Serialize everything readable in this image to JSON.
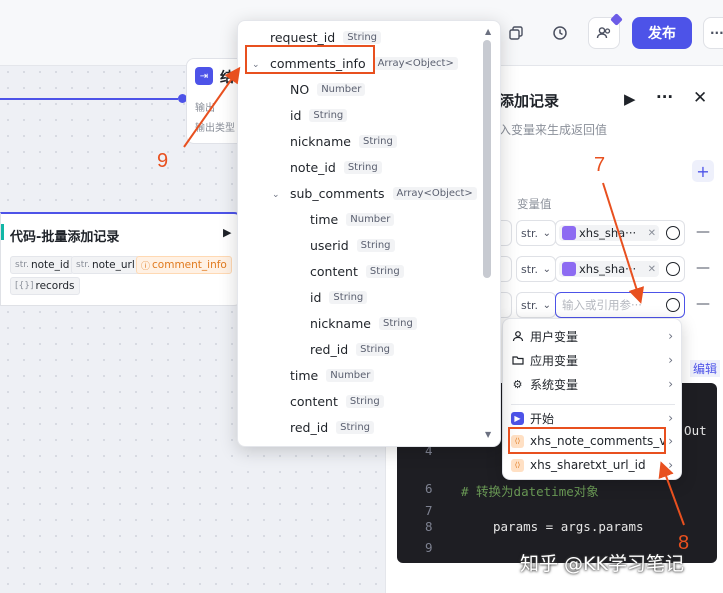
{
  "topbar": {
    "publish_label": "发布",
    "more_label": "···",
    "icons": [
      "copy-icon",
      "history-icon",
      "users-icon"
    ]
  },
  "end_node": {
    "title": "结",
    "output_label": "输出",
    "output_type_label": "输出类型"
  },
  "code_node": {
    "title": "代码-批量添加记录",
    "inputs": [
      {
        "type": "str.",
        "name": "note_id"
      },
      {
        "type": "str.",
        "name": "note_url"
      },
      {
        "type": "",
        "name": "comment_info"
      }
    ],
    "output": {
      "type": "[{}]",
      "name": "records"
    }
  },
  "tree": {
    "items": [
      {
        "name": "request_id",
        "type": "String"
      },
      {
        "name": "comments_info",
        "type": "Array<Object>"
      },
      {
        "name": "NO",
        "type": "Number"
      },
      {
        "name": "id",
        "type": "String"
      },
      {
        "name": "nickname",
        "type": "String"
      },
      {
        "name": "note_id",
        "type": "String"
      },
      {
        "name": "sub_comments",
        "type": "Array<Object>"
      },
      {
        "name": "time",
        "type": "Number"
      },
      {
        "name": "userid",
        "type": "String"
      },
      {
        "name": "content",
        "type": "String"
      },
      {
        "name": "id",
        "type": "String"
      },
      {
        "name": "nickname",
        "type": "String"
      },
      {
        "name": "red_id",
        "type": "String"
      },
      {
        "name": "time",
        "type": "Number"
      },
      {
        "name": "content",
        "type": "String"
      },
      {
        "name": "red_id",
        "type": "String"
      }
    ]
  },
  "panel": {
    "title": "添加记录",
    "subtitle": "入变量来生成返回值",
    "var_value_label": "变量值",
    "rows": [
      {
        "type": "str.",
        "value": "xhs_sha···"
      },
      {
        "type": "str.",
        "value": "xhs_sha···"
      },
      {
        "type": "str.",
        "placeholder": "输入或引用参···"
      }
    ],
    "edit_link": "编辑"
  },
  "var_menu": {
    "items": [
      {
        "label": "用户变量",
        "icon": "user-icon"
      },
      {
        "label": "应用变量",
        "icon": "folder-icon"
      },
      {
        "label": "系统变量",
        "icon": "gear-icon"
      },
      {
        "label": "开始",
        "icon": "start-node-icon"
      },
      {
        "label": "xhs_note_comments_v",
        "icon": "code-node-icon"
      },
      {
        "label": "xhs_sharetxt_url_id",
        "icon": "code-node-icon"
      }
    ]
  },
  "code": {
    "lines": [
      {
        "n": "4",
        "text": ""
      },
      {
        "n": "6",
        "text": "# 转换为datetime对象"
      },
      {
        "n": "7",
        "text": ""
      },
      {
        "n": "8",
        "text": "params = args.params"
      },
      {
        "n": "9",
        "text": ""
      }
    ],
    "side_text": "> Out"
  },
  "annotations": {
    "n7": "7",
    "n8": "8",
    "n9": "9",
    "color": "#e8501f"
  },
  "watermark": "知乎 @KK学习笔记"
}
